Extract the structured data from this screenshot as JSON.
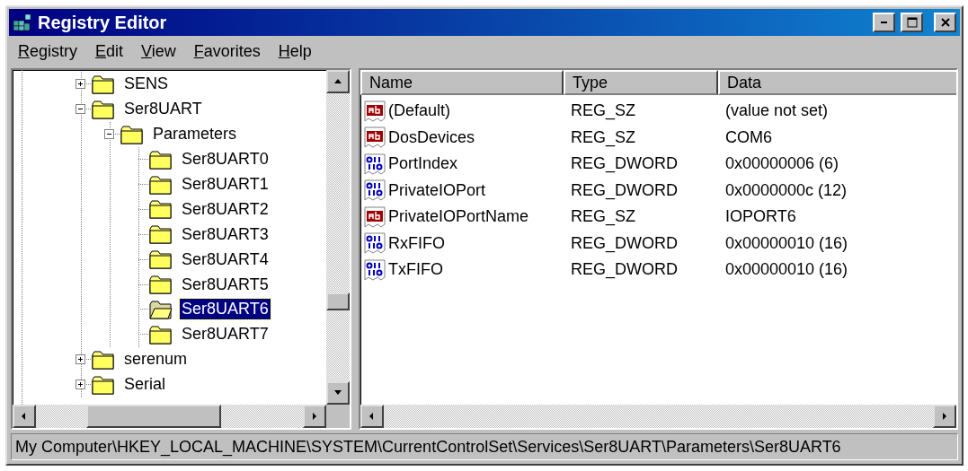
{
  "window": {
    "title": "Registry Editor"
  },
  "menu": [
    "Registry",
    "Edit",
    "View",
    "Favorites",
    "Help"
  ],
  "tree": [
    {
      "label": "SENS",
      "expanded": false,
      "selected": false
    },
    {
      "label": "Ser8UART",
      "expanded": true,
      "selected": false,
      "children": [
        {
          "label": "Parameters",
          "expanded": true,
          "selected": false,
          "children": [
            {
              "label": "Ser8UART0",
              "selected": false
            },
            {
              "label": "Ser8UART1",
              "selected": false
            },
            {
              "label": "Ser8UART2",
              "selected": false
            },
            {
              "label": "Ser8UART3",
              "selected": false
            },
            {
              "label": "Ser8UART4",
              "selected": false
            },
            {
              "label": "Ser8UART5",
              "selected": false
            },
            {
              "label": "Ser8UART6",
              "selected": true
            },
            {
              "label": "Ser8UART7",
              "selected": false
            }
          ]
        }
      ]
    },
    {
      "label": "serenum",
      "expanded": false,
      "selected": false
    },
    {
      "label": "Serial",
      "expanded": false,
      "selected": false
    }
  ],
  "list": {
    "columns": [
      "Name",
      "Type",
      "Data"
    ],
    "rows": [
      {
        "kind": "string",
        "name": "(Default)",
        "type": "REG_SZ",
        "data": "(value not set)"
      },
      {
        "kind": "string",
        "name": "DosDevices",
        "type": "REG_SZ",
        "data": "COM6"
      },
      {
        "kind": "dword",
        "name": "PortIndex",
        "type": "REG_DWORD",
        "data": "0x00000006 (6)"
      },
      {
        "kind": "dword",
        "name": "PrivateIOPort",
        "type": "REG_DWORD",
        "data": "0x0000000c (12)"
      },
      {
        "kind": "string",
        "name": "PrivateIOPortName",
        "type": "REG_SZ",
        "data": "IOPORT6"
      },
      {
        "kind": "dword",
        "name": "RxFIFO",
        "type": "REG_DWORD",
        "data": "0x00000010 (16)"
      },
      {
        "kind": "dword",
        "name": "TxFIFO",
        "type": "REG_DWORD",
        "data": "0x00000010 (16)"
      }
    ]
  },
  "status_bar": "My Computer\\HKEY_LOCAL_MACHINE\\SYSTEM\\CurrentControlSet\\Services\\Ser8UART\\Parameters\\Ser8UART6"
}
